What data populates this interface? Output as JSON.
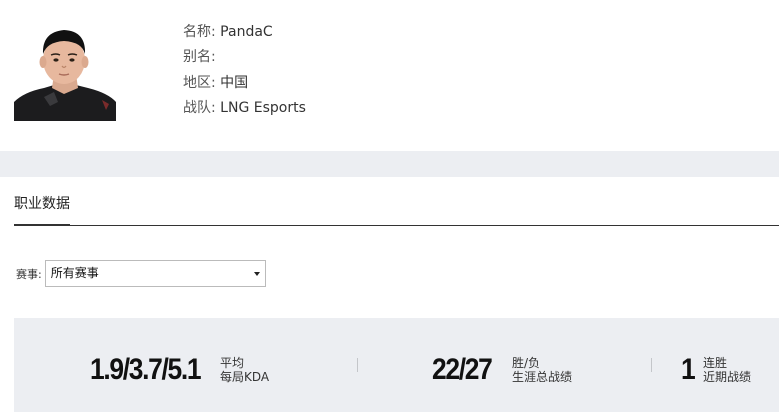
{
  "player": {
    "name_key": "名称:",
    "name": "PandaC",
    "alias_key": "别名:",
    "alias": "",
    "region_key": "地区:",
    "region": "中国",
    "team_key": "战队:",
    "team": "LNG Esports"
  },
  "tabs": {
    "career": "职业数据"
  },
  "filter": {
    "label": "赛事:",
    "selected": "所有赛事"
  },
  "stats": {
    "kda_value": "1.9/3.7/5.1",
    "kda_line1": "平均",
    "kda_line2": "每局KDA",
    "record_value": "22/27",
    "record_line1": "胜/负",
    "record_line2": "生涯总战绩",
    "streak_value": "1",
    "streak_line1": "连胜",
    "streak_line2": "近期战绩"
  },
  "colors": {
    "band": "#eceef2",
    "text": "#333333",
    "strong": "#111111"
  }
}
